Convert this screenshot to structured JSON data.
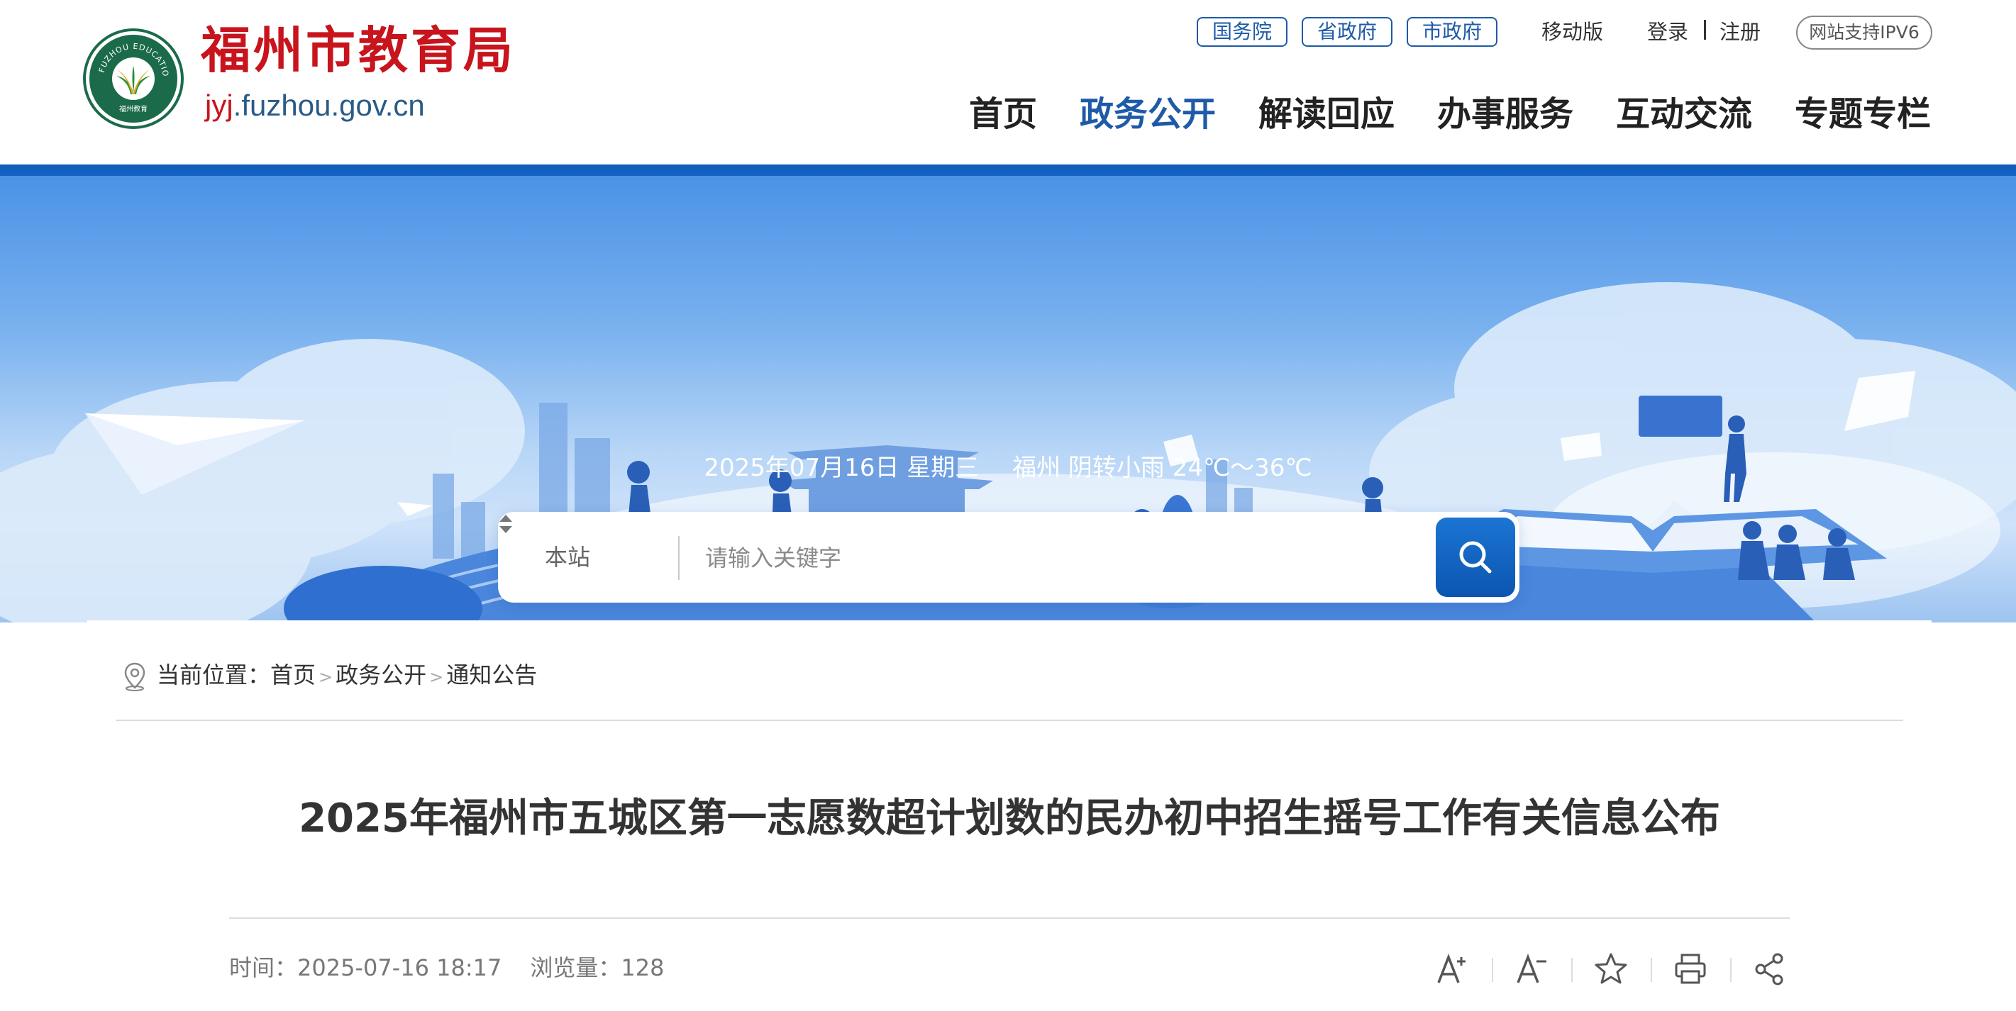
{
  "header": {
    "site_name": "福州市教育局",
    "domain_prefix": "jyj",
    "domain_suffix": ".fuzhou.gov.cn",
    "logo_ring_text": "FUZHOU EDUCATION",
    "logo_bottom_text": "福州教育",
    "top_links": {
      "state_council": "国务院",
      "province_gov": "省政府",
      "city_gov": "市政府",
      "mobile": "移动版",
      "login": "登录",
      "register": "注册",
      "ipv6": "网站支持IPV6"
    },
    "nav": [
      "首页",
      "政务公开",
      "解读回应",
      "办事服务",
      "互动交流",
      "专题专栏"
    ],
    "active_nav": "政务公开"
  },
  "banner": {
    "date": "2025年07月16日 星期三",
    "weather": "福州 阴转小雨 24℃～36℃",
    "search": {
      "scope": "本站",
      "placeholder": "请输入关键字"
    }
  },
  "article": {
    "breadcrumb": {
      "label": "当前位置：",
      "items": [
        "首页",
        "政务公开",
        "通知公告"
      ],
      "separator": ">"
    },
    "title": "2025年福州市五城区第一志愿数超计划数的民办初中招生摇号工作有关信息公布",
    "time_label": "时间：",
    "time": "2025-07-16 18:17",
    "views_label": "浏览量：",
    "views": "128",
    "tools": [
      "font-increase-icon",
      "font-decrease-icon",
      "star-icon",
      "print-icon",
      "share-icon"
    ]
  },
  "colors": {
    "brand_red": "#c8141d",
    "brand_blue": "#1e5aa8",
    "banner_blue": "#4b92e6",
    "search_button": "#0b56b0"
  }
}
